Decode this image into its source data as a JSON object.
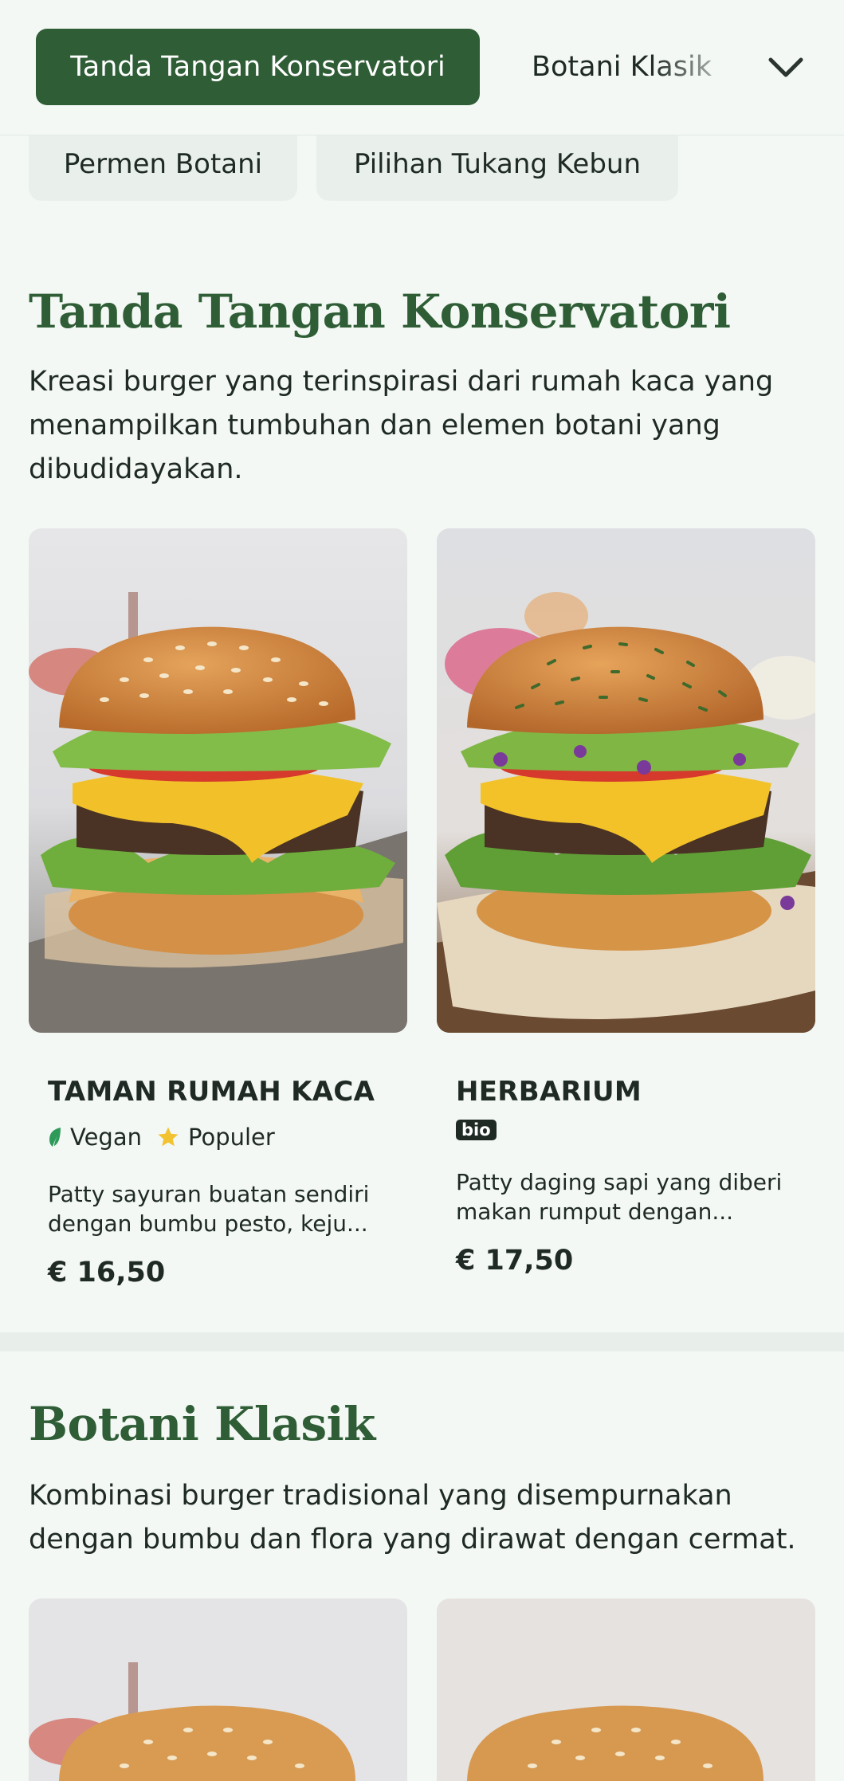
{
  "nav": {
    "active_tab": "Tanda Tangan Konservatori",
    "next_tab": "Botani Klasik",
    "dropdown_icon": "chevron-down-icon"
  },
  "filters": [
    "Permen Botani",
    "Pilihan Tukang Kebun"
  ],
  "sections": [
    {
      "title": "Tanda Tangan Konservatori",
      "description": "Kreasi burger yang terinspirasi dari rumah kaca yang menampilkan tumbuhan dan elemen botani yang dibudidayakan.",
      "items": [
        {
          "name": "TAMAN RUMAH KACA",
          "tags": [
            {
              "label": "Vegan",
              "icon": "leaf-icon",
              "color": "#2e9a5a"
            },
            {
              "label": "Populer",
              "icon": "star-icon",
              "color": "#f2c230"
            }
          ],
          "description": "Patty sayuran buatan sendiri dengan bumbu pesto, keju...",
          "price": "€ 16,50"
        },
        {
          "name": "HERBARIUM",
          "badge": "bio",
          "description": "Patty daging sapi yang diberi makan rumput dengan...",
          "price": "€ 17,50"
        }
      ]
    },
    {
      "title": "Botani Klasik",
      "description": "Kombinasi burger tradisional yang disempurnakan dengan bumbu dan flora yang dirawat dengan cermat."
    }
  ],
  "colors": {
    "brand": "#2f5d36",
    "background": "#f3f8f4"
  }
}
